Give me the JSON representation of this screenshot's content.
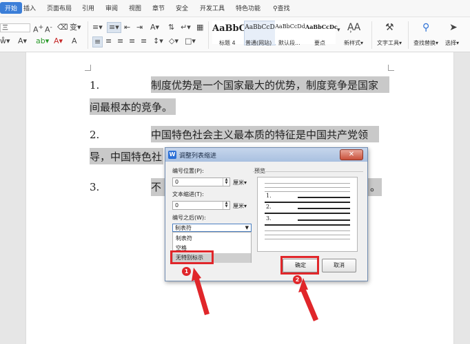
{
  "tabs": [
    "开始",
    "插入",
    "页面布局",
    "引用",
    "审阅",
    "视图",
    "章节",
    "安全",
    "开发工具",
    "特色功能",
    "查找"
  ],
  "ribbon": {
    "styles": [
      {
        "sample": "AaBbC",
        "caption": "标题 4"
      },
      {
        "sample": "AaBbCcD",
        "caption": "普通(网站)"
      },
      {
        "sample": "AaBbCcDd",
        "caption": "默认段..."
      },
      {
        "sample": "AaBbCcDc",
        "caption": "要点"
      }
    ],
    "new_style": "新样式",
    "text_tools": "文字工具",
    "find_replace": "查找替换",
    "select": "选择"
  },
  "document": {
    "items": [
      {
        "num": "1.",
        "line1": "制度优势是一个国家最大的优势，制度竞争是国家",
        "line2": "间最根本的竞争。"
      },
      {
        "num": "2.",
        "line1": "中国特色社会主义最本质的特征是中国共产党领",
        "line2": "导，中国特色社"
      },
      {
        "num": "3.",
        "line1": "不",
        "tail": "。"
      }
    ]
  },
  "dialog": {
    "title": "调整列表缩进",
    "number_position_label": "编号位置(P):",
    "number_position_value": "0",
    "text_indent_label": "文本缩进(T):",
    "text_indent_value": "0",
    "unit": "厘米",
    "after_number_label": "编号之后(W):",
    "after_number_selected": "制表符",
    "options": [
      "制表符",
      "空格",
      "无特别标示"
    ],
    "preview_label": "预览",
    "preview_numbers": [
      "1.",
      "2.",
      "3."
    ],
    "ok": "确定",
    "cancel": "取消"
  },
  "annotations": {
    "badge1": "1",
    "badge2": "2"
  },
  "colors": {
    "accent": "#3b7ed8",
    "annotation_red": "#e0262a",
    "highlight": "#c9c9c9"
  }
}
